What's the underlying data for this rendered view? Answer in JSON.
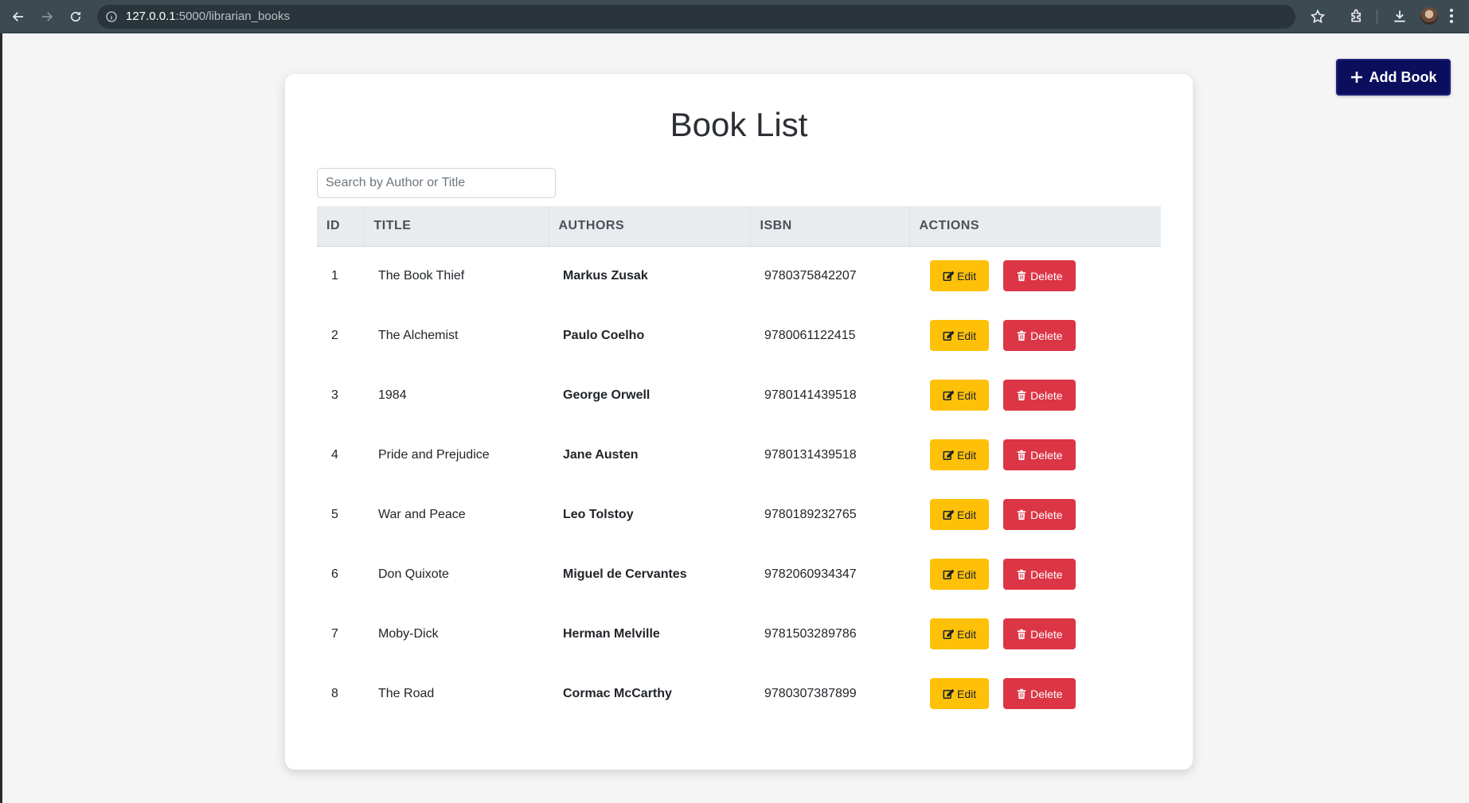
{
  "browser": {
    "url_host": "127.0.0.1",
    "url_path": ":5000/librarian_books"
  },
  "header": {
    "add_book_label": "Add Book"
  },
  "main": {
    "title": "Book List",
    "search_placeholder": "Search by Author or Title",
    "columns": [
      "ID",
      "TITLE",
      "AUTHORS",
      "ISBN",
      "ACTIONS"
    ],
    "edit_label": "Edit",
    "delete_label": "Delete",
    "books": [
      {
        "id": "1",
        "title": "The Book Thief",
        "author": "Markus Zusak",
        "isbn": "9780375842207"
      },
      {
        "id": "2",
        "title": "The Alchemist",
        "author": "Paulo Coelho",
        "isbn": "9780061122415"
      },
      {
        "id": "3",
        "title": "1984",
        "author": "George Orwell",
        "isbn": "9780141439518"
      },
      {
        "id": "4",
        "title": "Pride and Prejudice",
        "author": "Jane Austen",
        "isbn": "9780131439518"
      },
      {
        "id": "5",
        "title": "War and Peace",
        "author": "Leo Tolstoy",
        "isbn": "9780189232765"
      },
      {
        "id": "6",
        "title": "Don Quixote",
        "author": "Miguel de Cervantes",
        "isbn": "9782060934347"
      },
      {
        "id": "7",
        "title": "Moby-Dick",
        "author": "Herman Melville",
        "isbn": "9781503289786"
      },
      {
        "id": "8",
        "title": "The Road",
        "author": "Cormac McCarthy",
        "isbn": "9780307387899"
      }
    ]
  },
  "colors": {
    "add_button": "#0b0e5c",
    "edit_button": "#ffc107",
    "delete_button": "#dc3545"
  },
  "icons": {
    "add": "plus-icon",
    "edit": "edit-icon",
    "delete": "trash-icon"
  }
}
